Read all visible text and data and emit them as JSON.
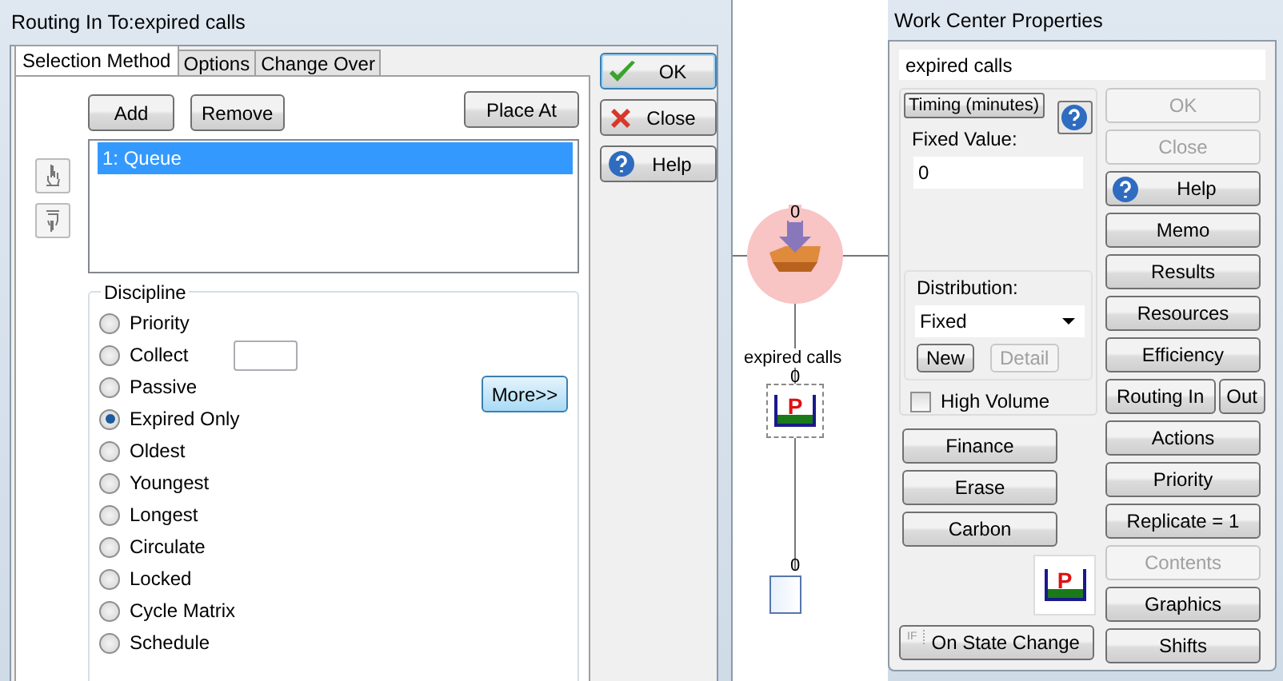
{
  "routing_dialog": {
    "title": "Routing In To:expired calls",
    "tabs": [
      {
        "label": "Selection Method",
        "selected": true
      },
      {
        "label": "Options",
        "selected": false
      },
      {
        "label": "Change Over",
        "selected": false
      }
    ],
    "toolbar_buttons": [
      "Add",
      "Remove"
    ],
    "place_button": "Place At",
    "routes": [
      {
        "label": "1: Queue",
        "selected": true
      }
    ],
    "discipline": {
      "title": "Discipline",
      "more_button": "More>>",
      "options": [
        {
          "label": "Priority",
          "kind": "radio",
          "selected": false
        },
        {
          "label": "Collect",
          "kind": "radio-field",
          "selected": false
        },
        {
          "label": "Passive",
          "kind": "radio",
          "selected": false
        },
        {
          "label": "Expired Only",
          "kind": "radio",
          "selected": true
        },
        {
          "label": "Oldest",
          "kind": "radio",
          "selected": false
        },
        {
          "label": "Youngest",
          "kind": "radio",
          "selected": false
        },
        {
          "label": "Longest",
          "kind": "radio",
          "selected": false
        },
        {
          "label": "Circulate",
          "kind": "radio",
          "selected": false
        },
        {
          "label": "Locked",
          "kind": "radio",
          "selected": false
        },
        {
          "label": "Cycle Matrix",
          "kind": "radio",
          "selected": false
        },
        {
          "label": "Schedule",
          "kind": "radio",
          "selected": false
        }
      ]
    },
    "side_buttons": [
      "OK",
      "Close",
      "Help"
    ]
  },
  "diagram": {
    "nodes": [
      {
        "kind": "entry",
        "count": "0"
      },
      {
        "kind": "queue",
        "label": "expired calls",
        "count": "0",
        "letter": "P"
      },
      {
        "kind": "exit",
        "count": "0"
      }
    ]
  },
  "properties_dialog": {
    "title": "Work Center Properties",
    "name_value": "expired calls",
    "timing_button": "Timing (minutes)",
    "fixed_value_label": "Fixed Value:",
    "fixed_value": "0",
    "distribution_label": "Distribution:",
    "distribution_value": "Fixed",
    "distribution_buttons": [
      {
        "label": "New",
        "disabled": false
      },
      {
        "label": "Detail",
        "disabled": true
      }
    ],
    "high_volume": {
      "label": "High Volume",
      "checked": false
    },
    "left_buttons": [
      "Finance",
      "Erase",
      "Carbon"
    ],
    "graphic_letter": "P",
    "state_button": {
      "icon_text": "IF",
      "label": "On State Change"
    },
    "actions": [
      {
        "kind": "button",
        "label": "OK",
        "disabled": true
      },
      {
        "kind": "button",
        "label": "Close",
        "disabled": true
      },
      {
        "kind": "help",
        "label": "Help",
        "disabled": false
      },
      {
        "kind": "button",
        "label": "Memo",
        "disabled": false
      },
      {
        "kind": "button",
        "label": "Results",
        "disabled": false
      },
      {
        "kind": "button",
        "label": "Resources",
        "disabled": false
      },
      {
        "kind": "button",
        "label": "Efficiency",
        "disabled": false
      },
      {
        "kind": "pair",
        "label": "Routing In",
        "second_label": "Out"
      },
      {
        "kind": "button",
        "label": "Actions",
        "disabled": false
      },
      {
        "kind": "button",
        "label": "Priority",
        "disabled": false
      },
      {
        "kind": "button",
        "label": "Replicate = 1",
        "disabled": false
      },
      {
        "kind": "button",
        "label": "Contents",
        "disabled": true
      },
      {
        "kind": "button",
        "label": "Graphics",
        "disabled": false
      },
      {
        "kind": "button",
        "label": "Shifts",
        "disabled": false
      }
    ]
  }
}
